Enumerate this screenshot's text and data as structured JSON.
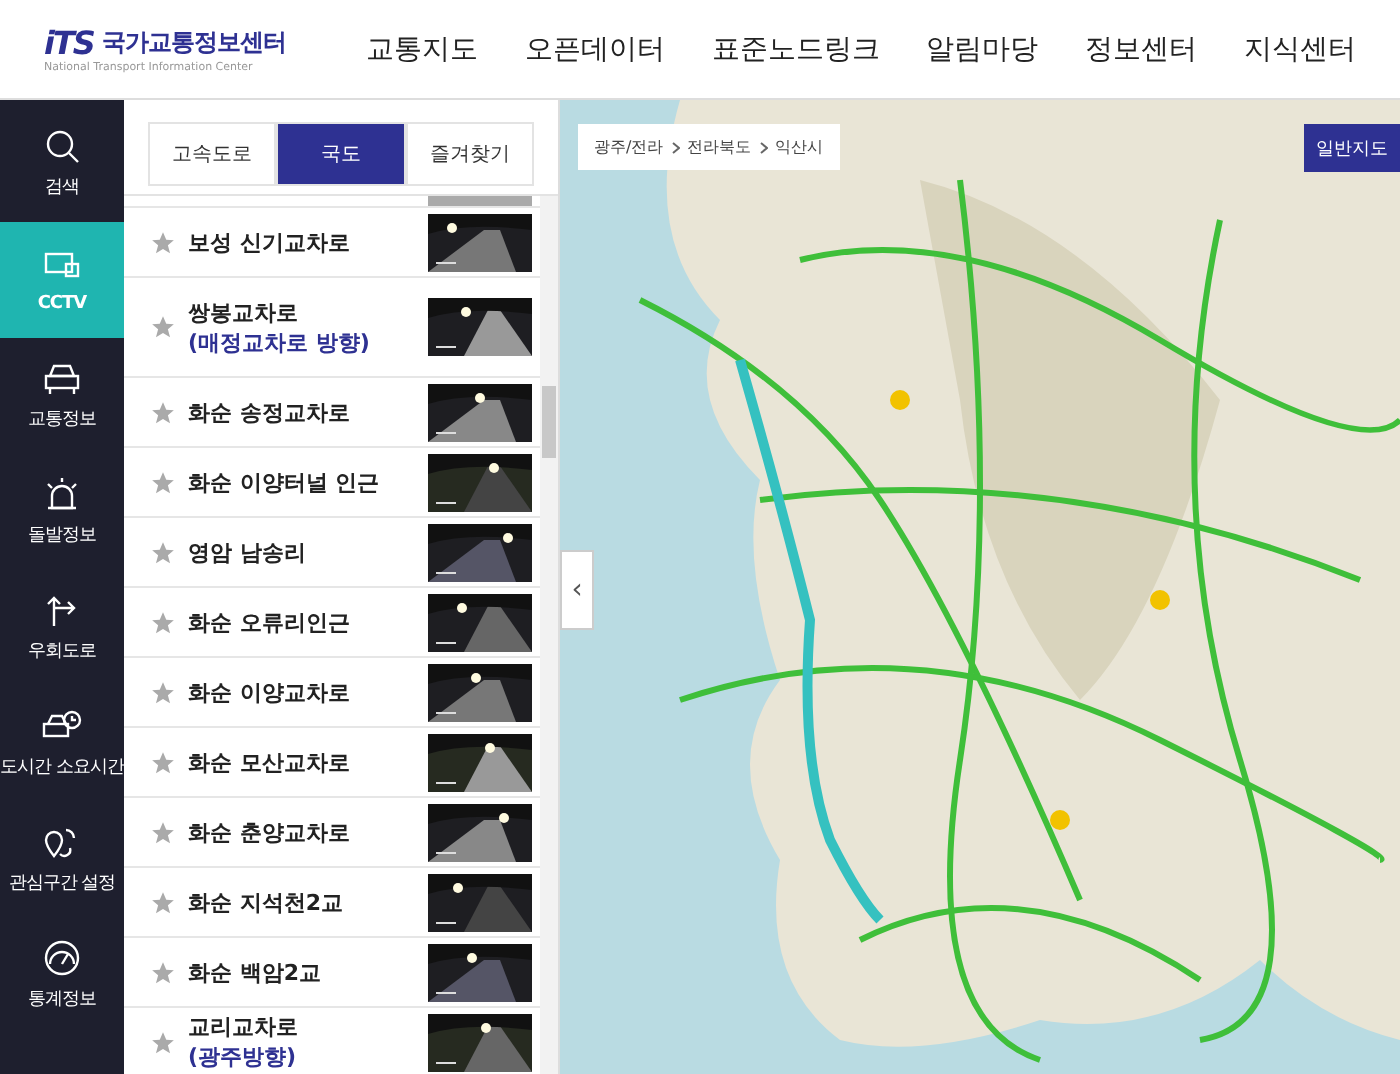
{
  "header": {
    "logo": {
      "mark": "iTS",
      "title": "국가교통정보센터",
      "subtitle": "National Transport Information Center"
    },
    "nav": [
      "교통지도",
      "오픈데이터",
      "표준노드링크",
      "알림마당",
      "정보센터",
      "지식센터"
    ]
  },
  "sidebar": {
    "items": [
      {
        "label": "검색",
        "kind": "search",
        "selected": false
      },
      {
        "label": "CCTV",
        "kind": "cctv",
        "selected": true
      },
      {
        "label": "교통정보",
        "kind": "car",
        "selected": false
      },
      {
        "label": "돌발정보",
        "kind": "alarm",
        "selected": false
      },
      {
        "label": "우회도로",
        "kind": "detour",
        "selected": false
      },
      {
        "label": "도시간 소요시간",
        "kind": "cartime",
        "selected": false
      },
      {
        "label": "관심구간 설정",
        "kind": "pin",
        "selected": false
      },
      {
        "label": "통계정보",
        "kind": "stats",
        "selected": false
      }
    ]
  },
  "tabs": [
    {
      "label": "고속도로",
      "selected": false
    },
    {
      "label": "국도",
      "selected": true
    },
    {
      "label": "즐겨찾기",
      "selected": false
    }
  ],
  "cameras": [
    {
      "name": "보성 신기교차로"
    },
    {
      "name": "쌍봉교차로",
      "sub": "(매정교차로 방향)"
    },
    {
      "name": "화순 송정교차로"
    },
    {
      "name": "화순 이양터널 인근"
    },
    {
      "name": "영암 남송리"
    },
    {
      "name": "화순 오류리인근"
    },
    {
      "name": "화순 이양교차로"
    },
    {
      "name": "화순 모산교차로"
    },
    {
      "name": "화순 춘양교차로"
    },
    {
      "name": "화순 지석천2교"
    },
    {
      "name": "화순 백암2교"
    },
    {
      "name": "교리교차로",
      "sub": "(광주방향)"
    }
  ],
  "map": {
    "breadcrumb": [
      "광주/전라",
      "전라북도",
      "익산시"
    ],
    "map_type_button": "일반지도",
    "collapse_button": "‹"
  }
}
